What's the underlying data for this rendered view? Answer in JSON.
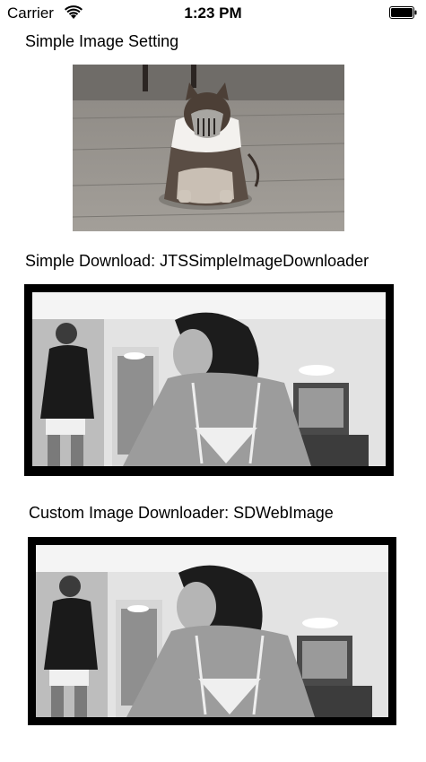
{
  "status_bar": {
    "carrier": "Carrier",
    "time": "1:23 PM",
    "icons": [
      "wifi-icon",
      "battery-icon"
    ]
  },
  "sections": [
    {
      "label": "Simple Image Setting",
      "image": "cat-in-mask-photo"
    },
    {
      "label": "Simple Download: JTSSimpleImageDownloader",
      "image": "room-photo-grayscale"
    },
    {
      "label": "Custom Image Downloader: SDWebImage",
      "image": "room-photo-grayscale"
    }
  ]
}
